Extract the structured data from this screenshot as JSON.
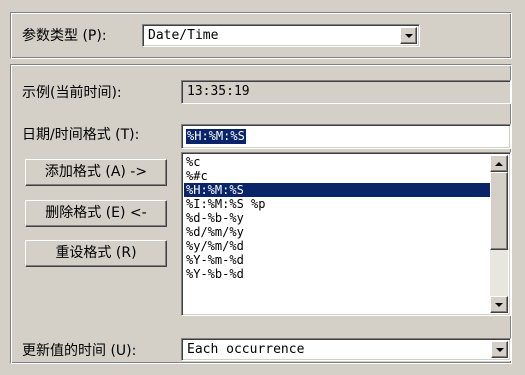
{
  "param_type": {
    "label": "参数类型 (P):",
    "value": "Date/Time"
  },
  "example": {
    "label": "示例(当前时间):",
    "value": "13:35:19"
  },
  "datetime_format": {
    "label": "日期/时间格式 (T):",
    "value": "%H:%M:%S"
  },
  "buttons": {
    "add": "添加格式 (A) ->",
    "delete": "删除格式 (E) <-",
    "reset": "重设格式 (R)"
  },
  "format_list": {
    "items": [
      "%c",
      "%#c",
      "%H:%M:%S",
      "%I:%M:%S %p",
      "%d-%b-%y",
      "%d/%m/%y",
      "%y/%m/%d",
      "%Y-%m-%d",
      "%Y-%b-%d"
    ],
    "selected": "%H:%M:%S"
  },
  "update_time": {
    "label": "更新值的时间 (U):",
    "value": "Each occurrence"
  },
  "colors": {
    "window_bg": "#d4d0c8",
    "selection_bg": "#0a246a",
    "selection_fg": "#ffffff"
  }
}
